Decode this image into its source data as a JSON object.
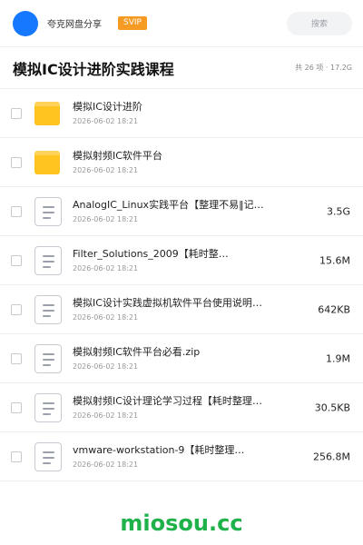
{
  "header": {
    "share_title": "夸克网盘分享",
    "vip_badge": "SVIP",
    "search_label": "搜索",
    "avatar_color": "#1677ff"
  },
  "folder": {
    "title": "模拟IC设计进阶实践课程",
    "meta": "共 26 项 · 17.2G"
  },
  "files": [
    {
      "name": "模拟IC设计进阶",
      "date": "2026-06-02 18:21",
      "size": "",
      "type": "folder"
    },
    {
      "name": "模拟射频IC软件平台",
      "date": "2026-06-02 18:21",
      "size": "",
      "type": "folder"
    },
    {
      "name": "AnalogIC_Linux实践平台【整理不易‖记…",
      "date": "2026-06-02 18:21",
      "size": "3.5G",
      "type": "file"
    },
    {
      "name": "Filter_Solutions_2009【耗时整…",
      "date": "2026-06-02 18:21",
      "size": "15.6M",
      "type": "file"
    },
    {
      "name": "模拟IC设计实践虚拟机软件平台使用说明【更多精选‖…",
      "date": "2026-06-02 18:21",
      "size": "642KB",
      "type": "file"
    },
    {
      "name": "模拟射频IC软件平台必看.zip",
      "date": "2026-06-02 18:21",
      "size": "1.9M",
      "type": "file"
    },
    {
      "name": "模拟射频IC设计理论学习过程【耗时整理‖不易且全免…",
      "date": "2026-06-02 18:21",
      "size": "30.5KB",
      "type": "file"
    },
    {
      "name": "vmware-workstation-9【耗时整理…",
      "date": "2026-06-02 18:21",
      "size": "256.8M",
      "type": "file"
    }
  ],
  "watermark": "miosou.cc",
  "colors": {
    "accent": "#1677ff",
    "vip": "#f59a23",
    "folder": "#ffc41f",
    "watermark": "#20b24a"
  }
}
